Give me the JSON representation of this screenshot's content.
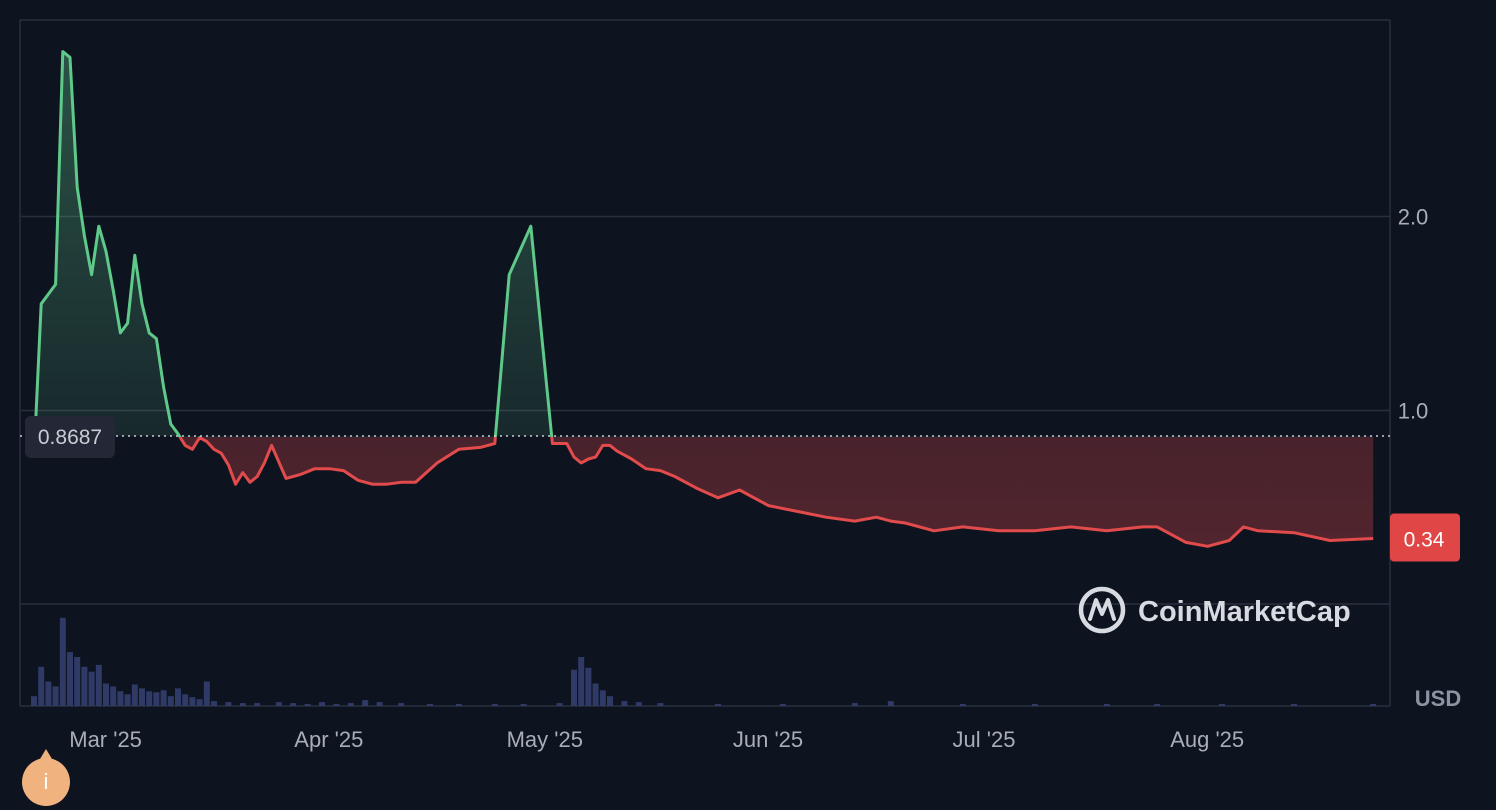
{
  "currency_label": "USD",
  "watermark": {
    "text": "CoinMarketCap",
    "icon": "coinmarketcap-logo-icon"
  },
  "info_button": {
    "label": "i",
    "icon": "info-icon"
  },
  "colors": {
    "background": "#0e1320",
    "grid": "#2a2f3d",
    "up": "#5fc98a",
    "down": "#e24b4b",
    "volume": "#2f3a66",
    "reference_badge": "#242836",
    "price_badge": "#e04646"
  },
  "chart_data": {
    "type": "line",
    "title": "",
    "xlabel": "",
    "ylabel": "",
    "y_ticks": [
      "1.0",
      "2.0"
    ],
    "ylim": [
      0.0,
      3.0
    ],
    "x_tick_labels": [
      "Mar '25",
      "Apr '25",
      "May '25",
      "Jun '25",
      "Jul '25",
      "Aug '25"
    ],
    "x_tick_dates": [
      "2025-03-01",
      "2025-04-01",
      "2025-05-01",
      "2025-06-01",
      "2025-07-01",
      "2025-08-01"
    ],
    "xlim": [
      "2025-02-26",
      "2025-08-31"
    ],
    "grid": true,
    "reference_value": 0.8687,
    "reference_label": "0.8687",
    "current_value": 0.34,
    "current_label": "0.34",
    "series": [
      {
        "type": "line",
        "x": [
          "2025-02-26",
          "2025-02-27",
          "2025-02-28",
          "2025-03-01",
          "2025-03-02",
          "2025-03-03",
          "2025-03-04",
          "2025-03-05",
          "2025-03-06",
          "2025-03-07",
          "2025-03-08",
          "2025-03-09",
          "2025-03-10",
          "2025-03-11",
          "2025-03-12",
          "2025-03-13",
          "2025-03-14",
          "2025-03-15",
          "2025-03-16",
          "2025-03-17",
          "2025-03-18",
          "2025-03-19",
          "2025-03-20",
          "2025-03-21",
          "2025-03-22",
          "2025-03-23",
          "2025-03-24",
          "2025-03-25",
          "2025-03-26",
          "2025-03-27",
          "2025-03-28",
          "2025-03-29",
          "2025-03-30",
          "2025-03-31",
          "2025-04-02",
          "2025-04-04",
          "2025-04-06",
          "2025-04-08",
          "2025-04-10",
          "2025-04-12",
          "2025-04-14",
          "2025-04-16",
          "2025-04-18",
          "2025-04-20",
          "2025-04-23",
          "2025-04-26",
          "2025-04-29",
          "2025-05-01",
          "2025-05-03",
          "2025-05-06",
          "2025-05-09",
          "2025-05-11",
          "2025-05-12",
          "2025-05-13",
          "2025-05-14",
          "2025-05-15",
          "2025-05-16",
          "2025-05-17",
          "2025-05-18",
          "2025-05-19",
          "2025-05-20",
          "2025-05-22",
          "2025-05-24",
          "2025-05-26",
          "2025-05-29",
          "2025-06-01",
          "2025-06-04",
          "2025-06-08",
          "2025-06-12",
          "2025-06-16",
          "2025-06-20",
          "2025-06-23",
          "2025-06-25",
          "2025-06-27",
          "2025-07-01",
          "2025-07-05",
          "2025-07-10",
          "2025-07-15",
          "2025-07-20",
          "2025-07-25",
          "2025-07-30",
          "2025-08-01",
          "2025-08-05",
          "2025-08-08",
          "2025-08-11",
          "2025-08-13",
          "2025-08-15",
          "2025-08-20",
          "2025-08-25",
          "2025-08-31"
        ],
        "y": [
          0.76,
          1.55,
          1.6,
          1.65,
          2.85,
          2.82,
          2.15,
          1.9,
          1.7,
          1.95,
          1.82,
          1.62,
          1.4,
          1.45,
          1.8,
          1.55,
          1.4,
          1.37,
          1.12,
          0.93,
          0.88,
          0.82,
          0.8,
          0.86,
          0.84,
          0.8,
          0.78,
          0.72,
          0.62,
          0.68,
          0.63,
          0.66,
          0.73,
          0.82,
          0.65,
          0.67,
          0.7,
          0.7,
          0.69,
          0.64,
          0.62,
          0.62,
          0.63,
          0.63,
          0.73,
          0.8,
          0.81,
          0.83,
          1.7,
          1.95,
          0.83,
          0.83,
          0.76,
          0.73,
          0.75,
          0.76,
          0.82,
          0.82,
          0.79,
          0.77,
          0.75,
          0.7,
          0.69,
          0.66,
          0.6,
          0.55,
          0.59,
          0.51,
          0.48,
          0.45,
          0.43,
          0.45,
          0.43,
          0.42,
          0.38,
          0.4,
          0.38,
          0.38,
          0.4,
          0.38,
          0.4,
          0.4,
          0.32,
          0.3,
          0.33,
          0.4,
          0.38,
          0.37,
          0.33,
          0.34
        ]
      },
      {
        "type": "bar",
        "name": "",
        "x": [
          "2025-02-26",
          "2025-02-27",
          "2025-02-28",
          "2025-03-01",
          "2025-03-02",
          "2025-03-03",
          "2025-03-04",
          "2025-03-05",
          "2025-03-06",
          "2025-03-07",
          "2025-03-08",
          "2025-03-09",
          "2025-03-10",
          "2025-03-11",
          "2025-03-12",
          "2025-03-13",
          "2025-03-14",
          "2025-03-15",
          "2025-03-16",
          "2025-03-17",
          "2025-03-18",
          "2025-03-19",
          "2025-03-20",
          "2025-03-21",
          "2025-03-22",
          "2025-03-23",
          "2025-03-25",
          "2025-03-27",
          "2025-03-29",
          "2025-04-01",
          "2025-04-03",
          "2025-04-05",
          "2025-04-07",
          "2025-04-09",
          "2025-04-11",
          "2025-04-13",
          "2025-04-15",
          "2025-04-18",
          "2025-04-22",
          "2025-04-26",
          "2025-05-01",
          "2025-05-05",
          "2025-05-10",
          "2025-05-12",
          "2025-05-13",
          "2025-05-14",
          "2025-05-15",
          "2025-05-16",
          "2025-05-17",
          "2025-05-19",
          "2025-05-21",
          "2025-05-24",
          "2025-06-01",
          "2025-06-10",
          "2025-06-20",
          "2025-06-25",
          "2025-07-05",
          "2025-07-15",
          "2025-07-25",
          "2025-08-01",
          "2025-08-10",
          "2025-08-20",
          "2025-08-31"
        ],
        "values": [
          0.1,
          0.4,
          0.25,
          0.2,
          0.9,
          0.55,
          0.5,
          0.4,
          0.35,
          0.42,
          0.23,
          0.2,
          0.15,
          0.12,
          0.22,
          0.18,
          0.15,
          0.14,
          0.16,
          0.1,
          0.18,
          0.12,
          0.09,
          0.07,
          0.25,
          0.05,
          0.04,
          0.03,
          0.03,
          0.04,
          0.03,
          0.02,
          0.04,
          0.02,
          0.03,
          0.06,
          0.04,
          0.03,
          0.02,
          0.02,
          0.02,
          0.02,
          0.03,
          0.37,
          0.5,
          0.39,
          0.23,
          0.16,
          0.1,
          0.05,
          0.04,
          0.03,
          0.02,
          0.02,
          0.03,
          0.05,
          0.02,
          0.02,
          0.02,
          0.02,
          0.02,
          0.02,
          0.01
        ]
      }
    ]
  }
}
